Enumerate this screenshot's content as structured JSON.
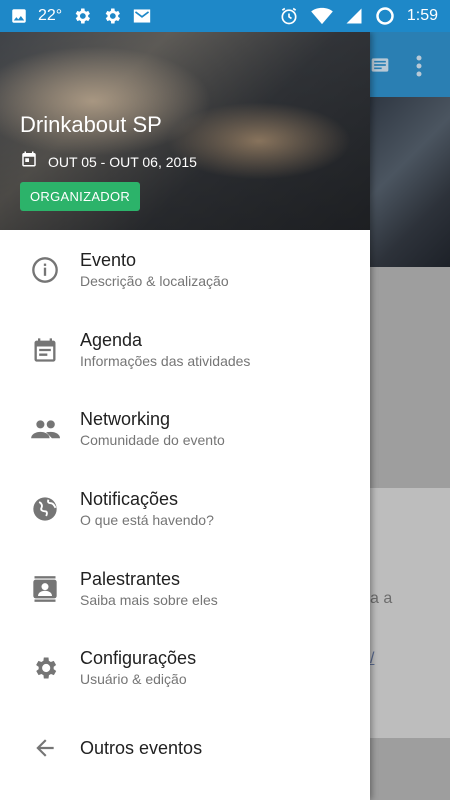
{
  "status_bar": {
    "temperature": "22°",
    "time": "1:59",
    "icons": [
      "image-icon",
      "gear-icon",
      "gear-icon",
      "mail-icon",
      "alarm-icon",
      "wifi-icon",
      "signal-icon",
      "battery-icon"
    ]
  },
  "event": {
    "title": "Drinkabout SP",
    "dates": "OUT 05 - OUT 06, 2015",
    "role_badge": "ORGANIZADOR"
  },
  "drawer": {
    "items": [
      {
        "title": "Evento",
        "subtitle": "Descrição & localização",
        "icon": "info-icon"
      },
      {
        "title": "Agenda",
        "subtitle": "Informações das atividades",
        "icon": "calendar-icon"
      },
      {
        "title": "Networking",
        "subtitle": "Comunidade do evento",
        "icon": "people-icon"
      },
      {
        "title": "Notificações",
        "subtitle": "O que está havendo?",
        "icon": "globe-icon"
      },
      {
        "title": "Palestrantes",
        "subtitle": "Saiba mais sobre eles",
        "icon": "contacts-icon"
      },
      {
        "title": "Configurações",
        "subtitle": "Usuário & edição",
        "icon": "settings-icon"
      },
      {
        "title": "Outros eventos",
        "icon": "arrow-back-icon"
      }
    ]
  },
  "background": {
    "card_text": "a a",
    "card_link": "/"
  },
  "colors": {
    "status_bar": "#1e88c8",
    "toolbar": "#2a7fb3",
    "badge": "#2cb36a"
  }
}
